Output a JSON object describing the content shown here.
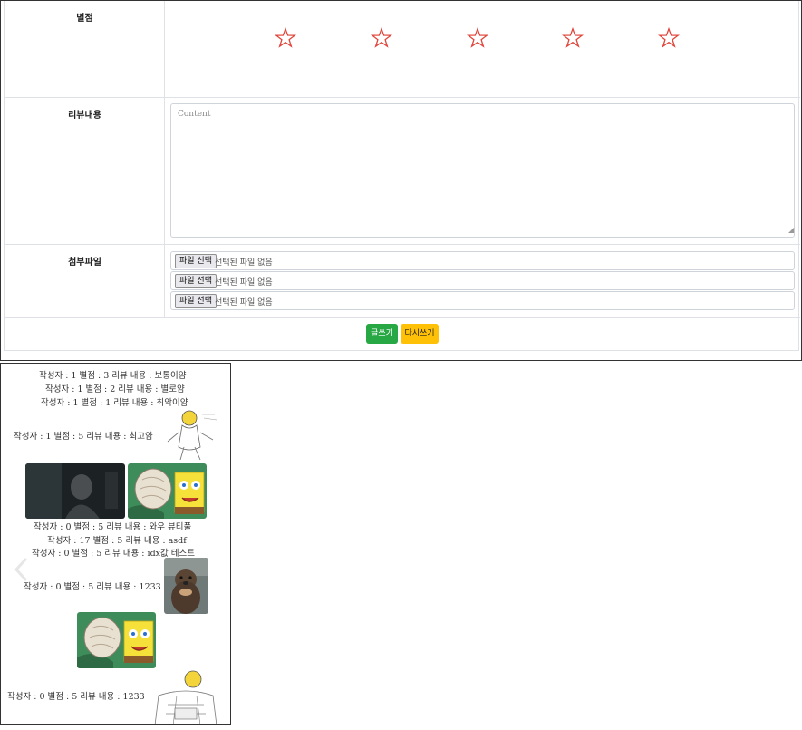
{
  "form": {
    "rating_label": "별점",
    "stars": [
      {
        "name": "star-1"
      },
      {
        "name": "star-2"
      },
      {
        "name": "star-3"
      },
      {
        "name": "star-4"
      },
      {
        "name": "star-5"
      }
    ],
    "star_color": "#e0453a",
    "rating_value": 0,
    "content_label": "리뷰내용",
    "content_placeholder": "Content",
    "files_label": "첨부파일",
    "file_button_label": "파일 선택",
    "file_status": "선택된 파일 없음",
    "submit_label": "글쓰기",
    "submit_color": "#28a745",
    "reset_label": "다시쓰기",
    "reset_color": "#ffc107"
  },
  "reviews": [
    {
      "text": "작성자 : 1 별점 : 3 리뷰 내용 : 보통이얌"
    },
    {
      "text": "작성자 : 1 별점 : 2 리뷰 내용 : 별로얌"
    },
    {
      "text": "작성자 : 1 별점 : 1 리뷰 내용 : 최악이얌"
    },
    {
      "text": "작성자 : 1 별점 : 5 리뷰 내용 : 최고얌"
    },
    {
      "text": "작성자 : 0 별점 : 5 리뷰 내용 : 와우 뷰티풀"
    },
    {
      "text": "작성자 : 17 별점 : 5 리뷰 내용 : asdf"
    },
    {
      "text": "작성자 : 0 별점 : 5 리뷰 내용 : idx값 테스트"
    },
    {
      "text": "작성자 : 0 별점 : 5 리뷰 내용 : 1233"
    },
    {
      "text": "작성자 : 0 별점 : 5 리뷰 내용 : 1233"
    }
  ],
  "carousel": {
    "prev_icon": "chevron-left-icon"
  }
}
